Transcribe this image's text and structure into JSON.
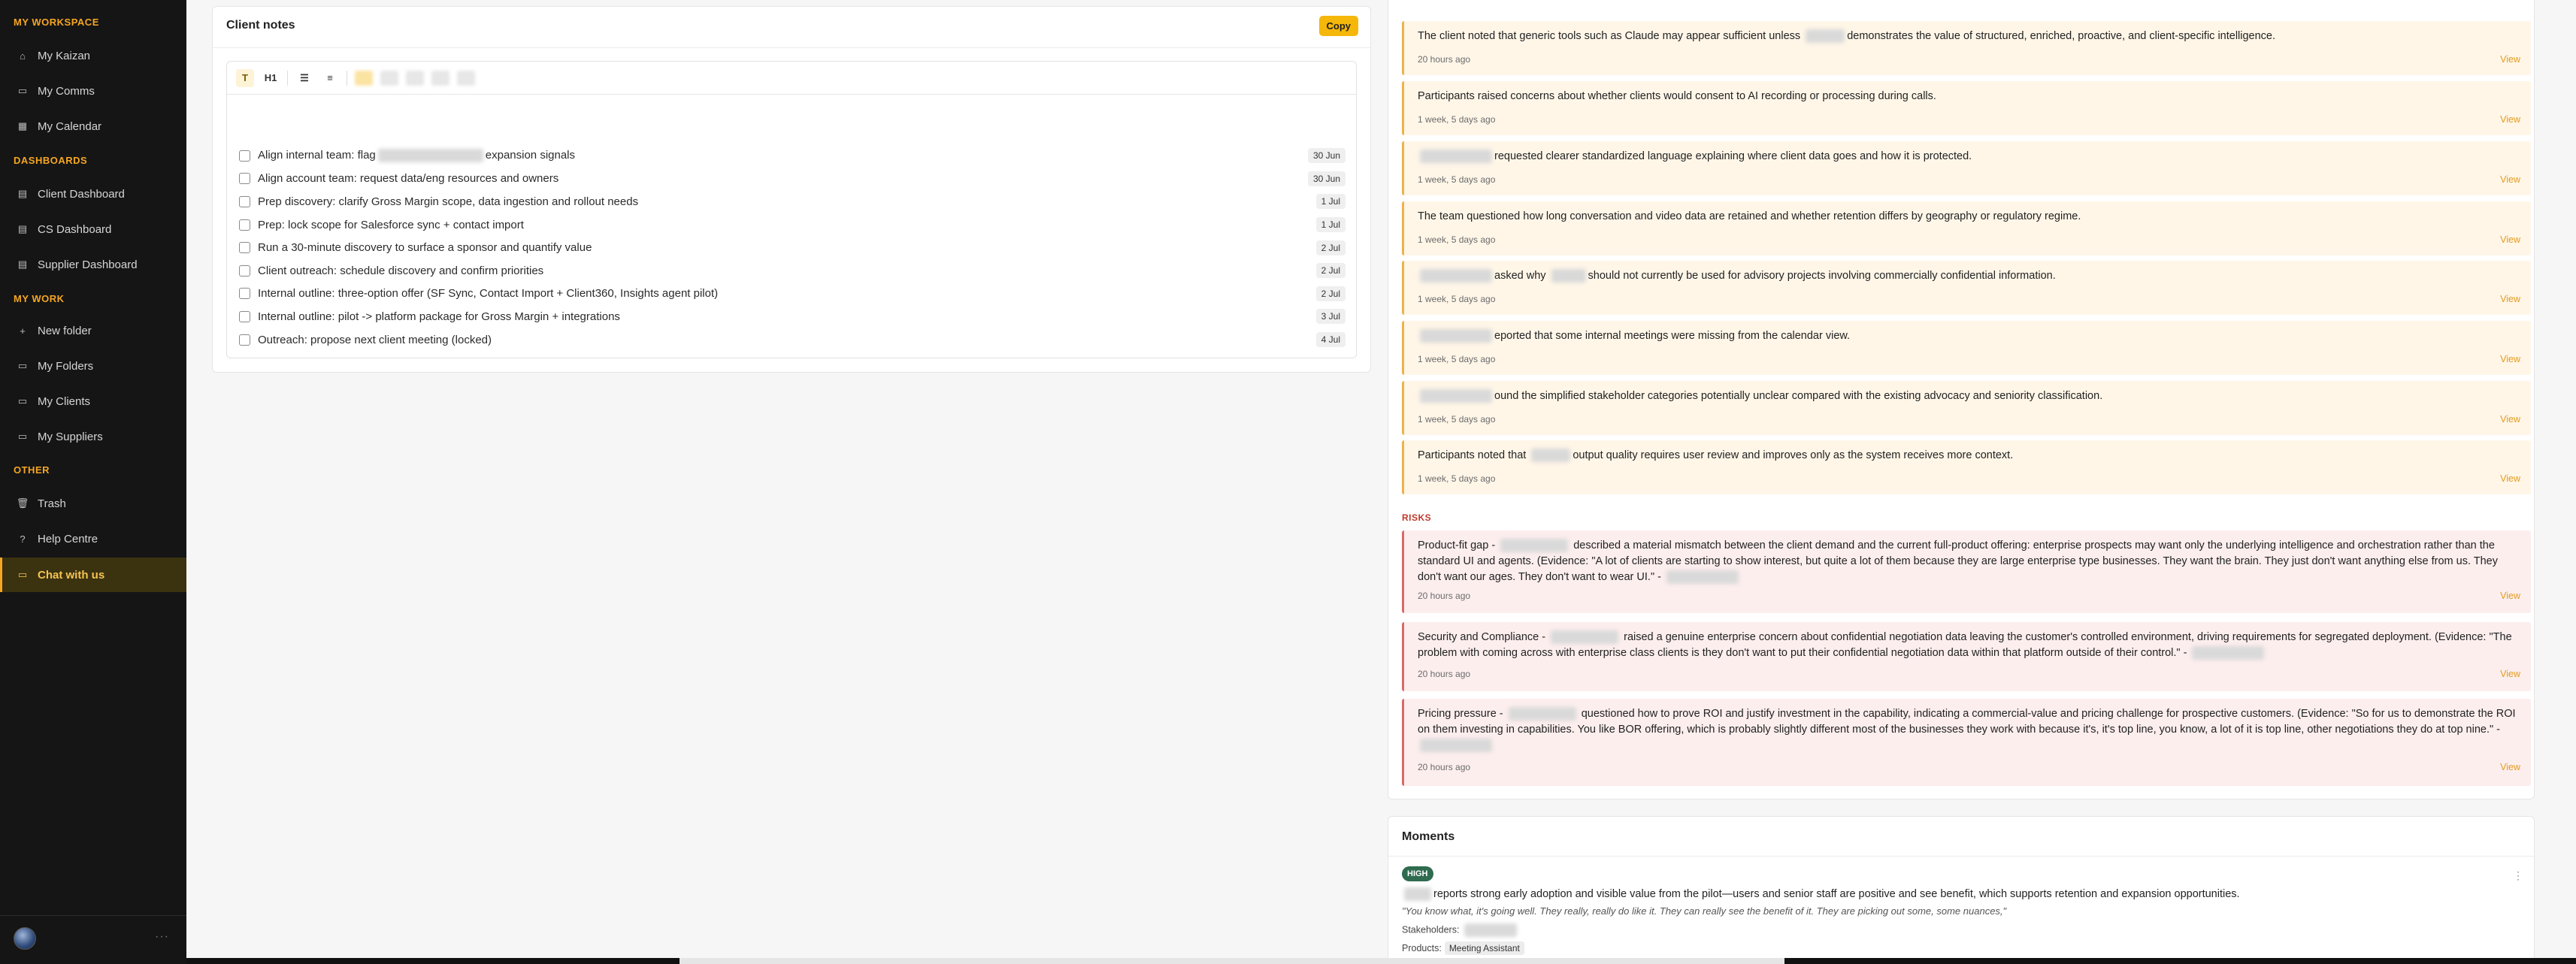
{
  "sidebar": {
    "sections": [
      {
        "label": "MY WORKSPACE",
        "items": [
          {
            "label": "My Kaizan",
            "icon": "home-icon"
          },
          {
            "label": "My Comms",
            "icon": "chat-icon"
          },
          {
            "label": "My Calendar",
            "icon": "calendar-icon"
          }
        ]
      },
      {
        "label": "DASHBOARDS",
        "items": [
          {
            "label": "Client Dashboard",
            "icon": "dashboard-icon"
          },
          {
            "label": "CS Dashboard",
            "icon": "dashboard-icon"
          },
          {
            "label": "Supplier Dashboard",
            "icon": "dashboard-icon"
          }
        ]
      },
      {
        "label": "MY WORK",
        "items": [
          {
            "label": "New folder",
            "icon": "plus-icon"
          },
          {
            "label": "My Folders",
            "icon": "folder-icon"
          },
          {
            "label": "My Clients",
            "icon": "clients-icon"
          },
          {
            "label": "My Suppliers",
            "icon": "suppliers-icon"
          }
        ]
      },
      {
        "label": "OTHER",
        "items": [
          {
            "label": "Trash",
            "icon": "trash-icon"
          },
          {
            "label": "Help Centre",
            "icon": "help-icon"
          },
          {
            "label": "Chat with us",
            "icon": "message-icon",
            "active": true
          }
        ]
      }
    ],
    "more": "···"
  },
  "notes": {
    "title": "Client notes",
    "copy_label": "Copy",
    "toolbar": {
      "t": "T",
      "h1": "H1",
      "bullets": "☰",
      "numbered": "≡"
    },
    "tasks": [
      {
        "pre": "Align internal team: flag",
        "blur": true,
        "post": "expansion signals",
        "due": "30 Jun"
      },
      {
        "pre": "Align account team: request data/eng resources and owners",
        "due": "30 Jun"
      },
      {
        "pre": "Prep discovery: clarify Gross Margin scope, data ingestion and rollout needs",
        "due": "1 Jul"
      },
      {
        "pre": "Prep: lock scope for Salesforce sync + contact import",
        "due": "1 Jul"
      },
      {
        "pre": "Run a 30-minute discovery to surface a sponsor and quantify value",
        "due": "2 Jul"
      },
      {
        "pre": "Client outreach: schedule discovery and confirm priorities",
        "due": "2 Jul"
      },
      {
        "pre": "Internal outline: three-option offer (SF Sync, Contact Import + Client360, Insights agent pilot)",
        "due": "2 Jul"
      },
      {
        "pre": "Internal outline: pilot -> platform package for Gross Margin + integrations",
        "due": "3 Jul"
      },
      {
        "pre": "Outreach: propose next client meeting (locked)",
        "due": "4 Jul"
      }
    ]
  },
  "insights": {
    "view_label": "View",
    "notes": [
      {
        "pre": "The client noted that generic tools such as Claude may appear sufficient unless",
        "blur": true,
        "post": "demonstrates the value of structured, enriched, proactive, and client-specific intelligence.",
        "time": "20 hours ago"
      },
      {
        "pre": "Participants raised concerns about whether clients would consent to AI recording or processing during calls.",
        "time": "1 week, 5 days ago"
      },
      {
        "pre": "",
        "blur": true,
        "post": "requested clearer standardized language explaining where client data goes and how it is protected.",
        "time": "1 week, 5 days ago"
      },
      {
        "pre": "The team questioned how long conversation and video data are retained and whether retention differs by geography or regulatory regime.",
        "time": "1 week, 5 days ago"
      },
      {
        "pre": "",
        "blur": true,
        "post": "asked why",
        "blur2": true,
        "post2": "should not currently be used for advisory projects involving commercially confidential information.",
        "time": "1 week, 5 days ago"
      },
      {
        "pre": "",
        "blur": true,
        "post": "eported that some internal meetings were missing from the calendar view.",
        "time": "1 week, 5 days ago"
      },
      {
        "pre": "",
        "blur": true,
        "post": "ound the simplified stakeholder categories potentially unclear compared with the existing advocacy and seniority classification.",
        "time": "1 week, 5 days ago"
      },
      {
        "pre": "Participants noted that",
        "blur": true,
        "post": "output quality requires user review and improves only as the system receives more context.",
        "time": "1 week, 5 days ago"
      }
    ],
    "risks_label": "RISKS",
    "risks": [
      {
        "pre": "Product-fit gap -",
        "blur": true,
        "post": "described a material mismatch between the client demand and the current full-product offering: enterprise prospects may want only the underlying intelligence and orchestration rather than the standard UI and agents. (Evidence: \"A lot of clients are starting to show interest, but quite a lot of them because they are large enterprise type businesses. They want the brain. They just don't want anything else from us. They don't want our ages. They don't want to wear UI.\" -",
        "time": "20 hours ago"
      },
      {
        "pre": "Security and Compliance -",
        "blur": true,
        "post": "raised a genuine enterprise concern about confidential negotiation data leaving the customer's controlled environment, driving requirements for segregated deployment. (Evidence: \"The problem with coming across with enterprise class clients is they don't want to put their confidential negotiation data within that platform outside of their control.\" -",
        "time": "20 hours ago"
      },
      {
        "pre": "Pricing pressure -",
        "blur": true,
        "post": "questioned how to prove ROI and justify investment in the capability, indicating a commercial-value and pricing challenge for prospective customers. (Evidence: \"So for us to demonstrate the ROI on them investing in capabilities. You like BOR offering, which is probably slightly different most of the businesses they work with because it's, it's top line, you know, a lot of it is top line, other negotiations they do at top nine.\" -",
        "time": "20 hours ago"
      }
    ]
  },
  "moments": {
    "title": "Moments",
    "badge": "HIGH",
    "text": "reports strong early adoption and visible value from the pilot—users and senior staff are positive and see benefit, which supports retention and expansion opportunities.",
    "quote": "\"You know what, it's going well. They really, really do like it. They can really see the benefit of it. They are picking out some, some nuances,\"",
    "stakeholders_label": "Stakeholders:",
    "products_label": "Products:",
    "product_tag": "Meeting Assistant",
    "kebab": "⋮"
  }
}
